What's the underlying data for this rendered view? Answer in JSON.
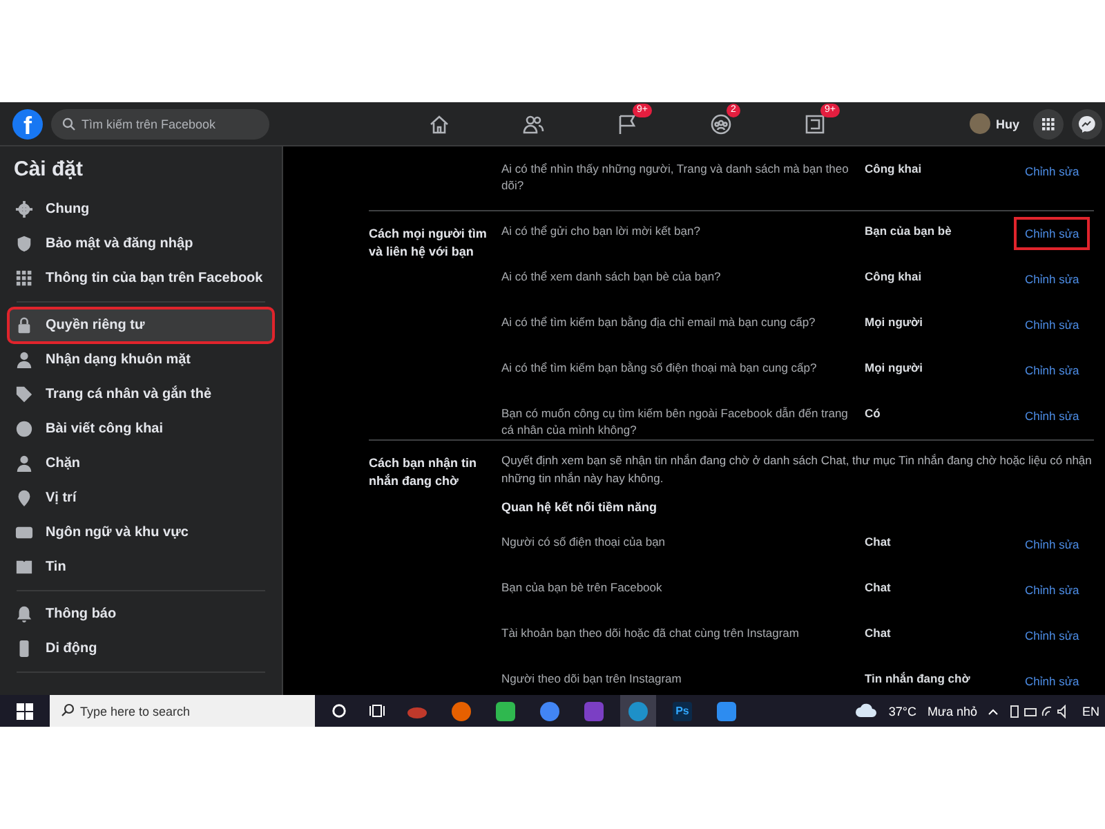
{
  "top_bar": {
    "logo": "f",
    "search": {
      "placeholder": "Tìm kiếm trên Facebook"
    },
    "nav_badges": [
      "9+",
      "2",
      "9+"
    ],
    "profile": {
      "name": "Huy"
    }
  },
  "sidebar": {
    "title": "Cài đặt",
    "groups": [
      [
        {
          "label": "Chung",
          "selected": false
        },
        {
          "label": "Bảo mật và đăng nhập",
          "selected": false
        },
        {
          "label": "Thông tin của bạn trên Facebook",
          "selected": false
        }
      ],
      [
        {
          "label": "Quyền riêng tư",
          "selected": true
        },
        {
          "label": "Nhận dạng khuôn mặt",
          "selected": false
        },
        {
          "label": "Trang cá nhân và gắn thẻ",
          "selected": false
        },
        {
          "label": "Bài viết công khai",
          "selected": false
        },
        {
          "label": "Chặn",
          "selected": false
        },
        {
          "label": "Vị trí",
          "selected": false
        },
        {
          "label": "Ngôn ngữ và khu vực",
          "selected": false
        },
        {
          "label": "Tin",
          "selected": false
        }
      ],
      [
        {
          "label": "Thông báo",
          "selected": false
        },
        {
          "label": "Di động",
          "selected": false
        }
      ]
    ]
  },
  "sections": [
    {
      "rows": [
        {
          "question": "Ai có thể nhìn thấy những người, Trang và danh sách mà bạn theo dõi?",
          "value": "Công khai",
          "action": "Chỉnh sửa",
          "highlighted": false
        }
      ]
    },
    {
      "label": "Cách mọi người tìm và liên hệ với bạn",
      "rows": [
        {
          "question": "Ai có thể gửi cho bạn lời mời kết bạn?",
          "value": "Bạn của bạn bè",
          "action": "Chỉnh sửa",
          "highlighted": true
        },
        {
          "question": "Ai có thể xem danh sách bạn bè của bạn?",
          "value": "Công khai",
          "action": "Chỉnh sửa",
          "highlighted": false
        },
        {
          "question": "Ai có thể tìm kiếm bạn bằng địa chỉ email mà bạn cung cấp?",
          "value": "Mọi người",
          "action": "Chỉnh sửa",
          "highlighted": false
        },
        {
          "question": "Ai có thể tìm kiếm bạn bằng số điện thoại mà bạn cung cấp?",
          "value": "Mọi người",
          "action": "Chỉnh sửa",
          "highlighted": false
        },
        {
          "question": "Bạn có muốn công cụ tìm kiếm bên ngoài Facebook dẫn đến trang cá nhân của mình không?",
          "value": "Có",
          "action": "Chỉnh sửa",
          "highlighted": false
        }
      ]
    },
    {
      "label": "Cách bạn nhận tin nhắn đang chờ",
      "description": "Quyết định xem bạn sẽ nhận tin nhắn đang chờ ở danh sách Chat, thư mục Tin nhắn đang chờ hoặc liệu có nhận những tin nhắn này hay không.",
      "subheading": "Quan hệ kết nối tiềm năng",
      "rows": [
        {
          "question": "Người có số điện thoại của bạn",
          "value": "Chat",
          "action": "Chỉnh sửa",
          "highlighted": false
        },
        {
          "question": "Bạn của bạn bè trên Facebook",
          "value": "Chat",
          "action": "Chỉnh sửa",
          "highlighted": false
        },
        {
          "question": "Tài khoản bạn theo dõi hoặc đã chat cùng trên Instagram",
          "value": "Chat",
          "action": "Chỉnh sửa",
          "highlighted": false
        },
        {
          "question": "Người theo dõi bạn trên Instagram",
          "value": "Tin nhắn đang chờ",
          "action": "Chỉnh sửa",
          "highlighted": false
        }
      ]
    }
  ],
  "taskbar": {
    "search": {
      "placeholder": "Type here to search"
    },
    "apps": [
      {
        "color": "#c0392b",
        "selected": false
      },
      {
        "color": "#e66000",
        "selected": false
      },
      {
        "color": "#2fb84f",
        "selected": false
      },
      {
        "color": "#4285f4",
        "selected": false
      },
      {
        "color": "#7b3fc4",
        "selected": false
      },
      {
        "color": "#1e90c8",
        "selected": true
      },
      {
        "color": "#0b2a4a",
        "selected": false
      },
      {
        "color": "#2d8cf0",
        "selected": false
      }
    ],
    "ps_label": "Ps",
    "temperature": "37°C",
    "weather": "Mưa nhỏ",
    "language": "EN"
  }
}
